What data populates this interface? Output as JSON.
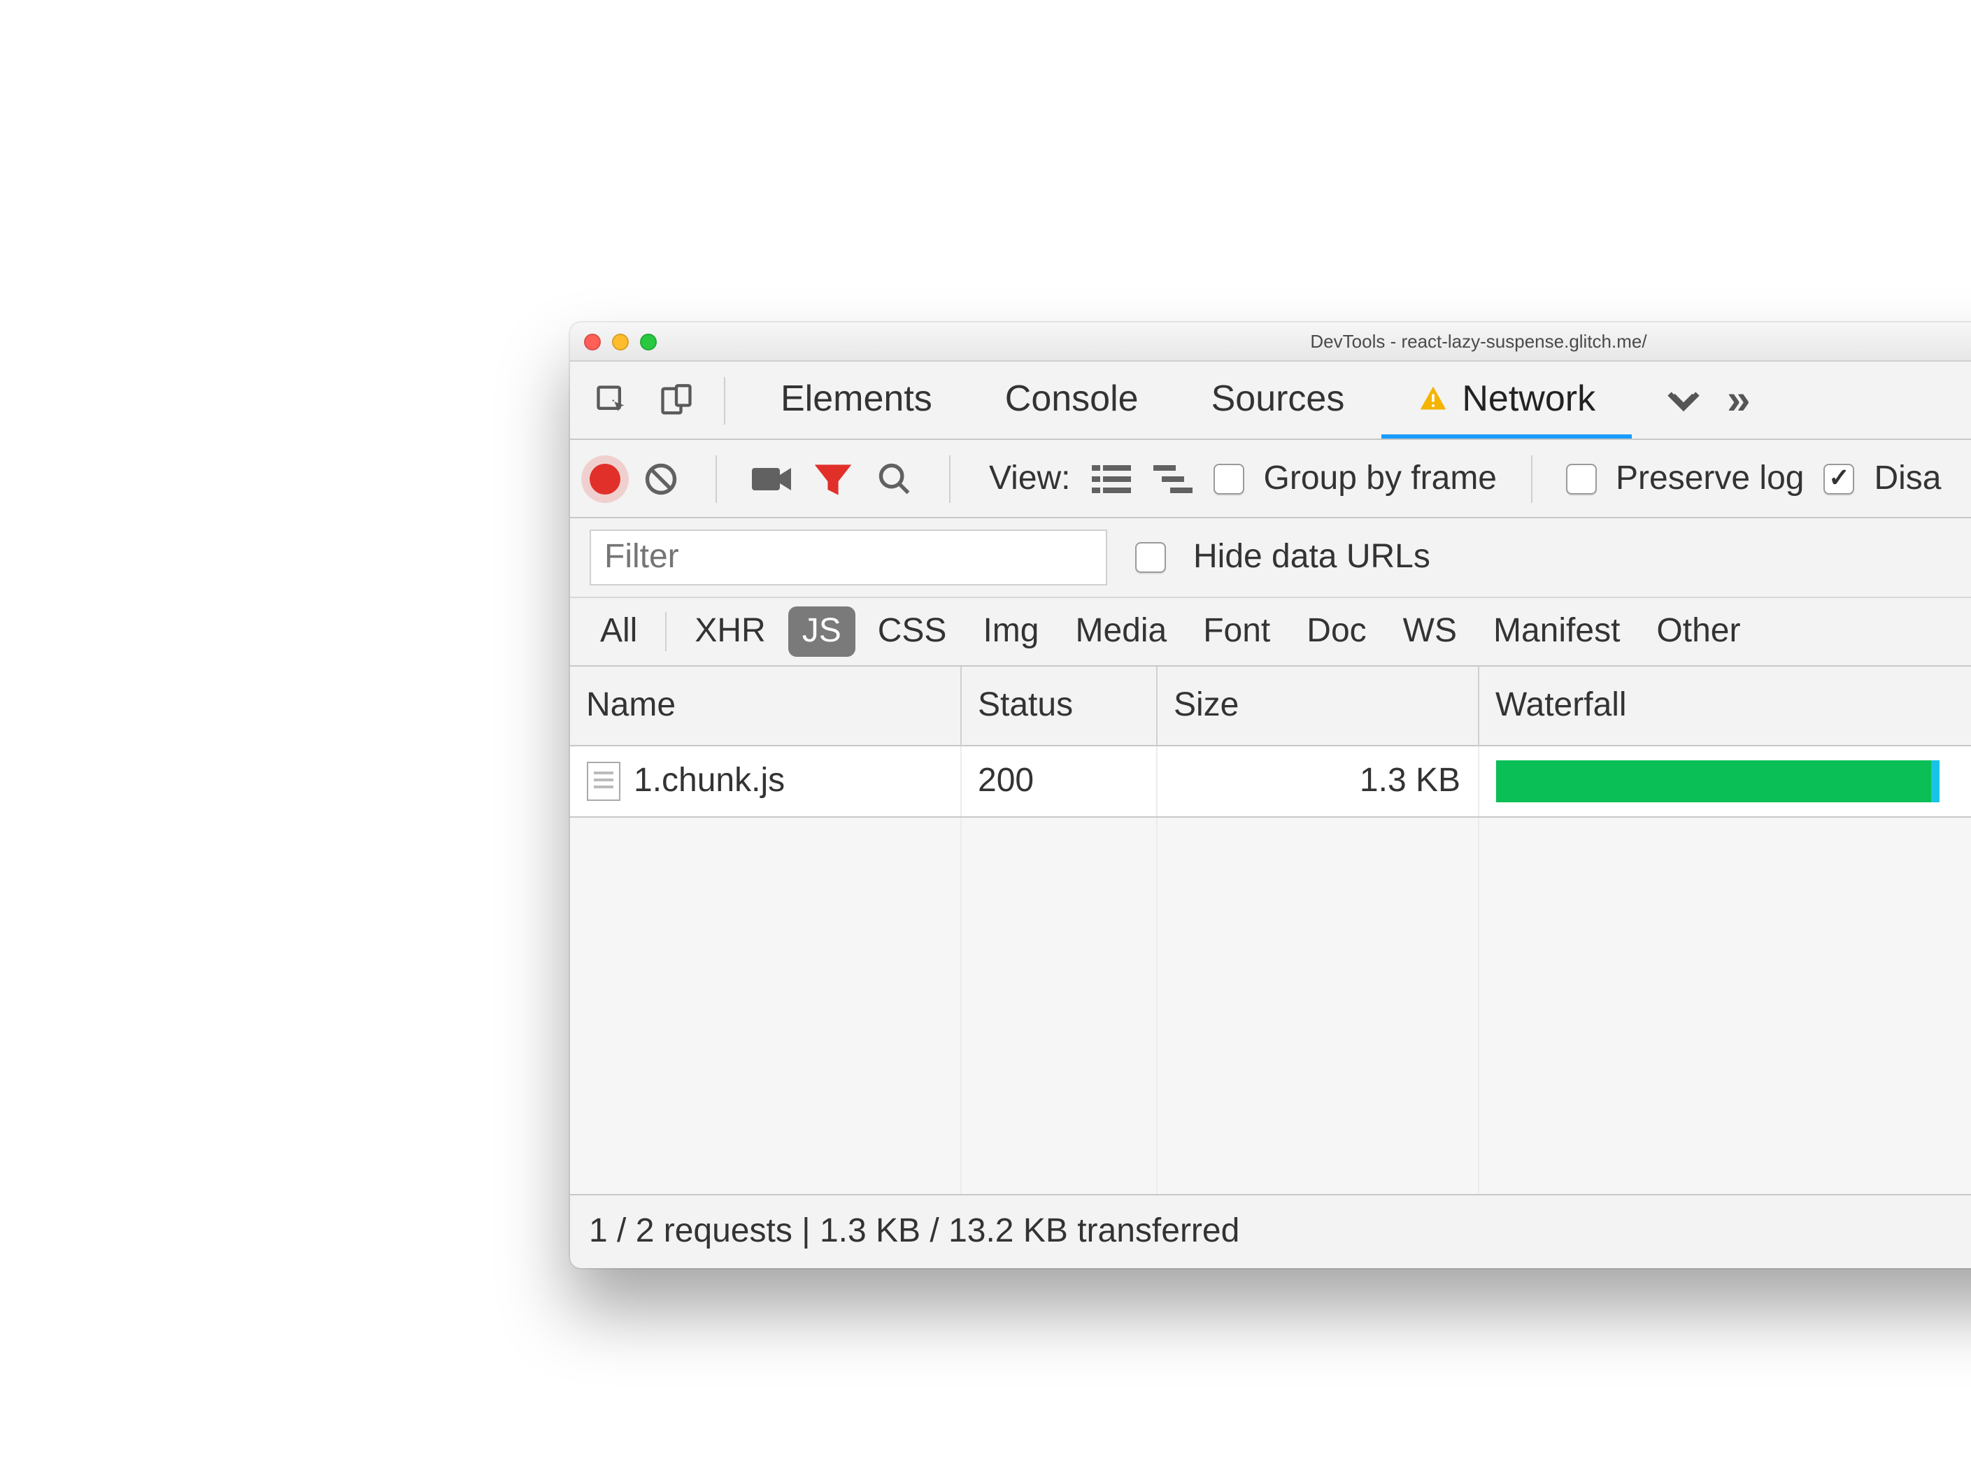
{
  "titlebar": {
    "title": "DevTools - react-lazy-suspense.glitch.me/"
  },
  "tabs": {
    "items": [
      "Elements",
      "Console",
      "Sources",
      "Network"
    ],
    "active_index": 3,
    "has_warning_on_active": true
  },
  "toolbar": {
    "view_label": "View:",
    "group_by_frame_label": "Group by frame",
    "group_by_frame_checked": false,
    "preserve_log_label": "Preserve log",
    "preserve_log_checked": false,
    "disable_cache_label": "Disa",
    "disable_cache_checked": true
  },
  "filter_row": {
    "placeholder": "Filter",
    "value": "",
    "hide_data_urls_label": "Hide data URLs",
    "hide_data_urls_checked": false
  },
  "type_filters": {
    "items": [
      "All",
      "XHR",
      "JS",
      "CSS",
      "Img",
      "Media",
      "Font",
      "Doc",
      "WS",
      "Manifest",
      "Other"
    ],
    "active_index": 2
  },
  "table": {
    "columns": [
      "Name",
      "Status",
      "Size",
      "Waterfall"
    ],
    "sort_column_index": 3,
    "rows": [
      {
        "name": "1.chunk.js",
        "status": "200",
        "size": "1.3 KB",
        "waterfall_pct": 50
      }
    ]
  },
  "status_bar": {
    "text": "1 / 2 requests | 1.3 KB / 13.2 KB transferred"
  }
}
